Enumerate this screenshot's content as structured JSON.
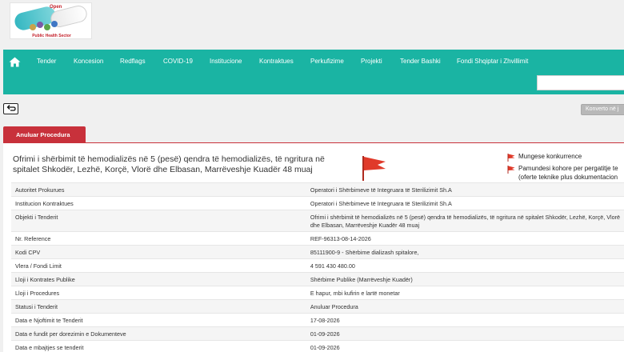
{
  "logo": {
    "brand": "Open",
    "caption": "Public Health Sector"
  },
  "nav": {
    "items": [
      "Tender",
      "Koncesion",
      "Redflags",
      "COVID-19",
      "Institucione",
      "Kontraktues",
      "Perkufizime",
      "Projekti",
      "Tender Bashki",
      "Fondi Shqiptar i Zhvillimit"
    ],
    "search_value": ""
  },
  "toolbar": {
    "convert_label": "Konverto në j"
  },
  "tab": {
    "label": "Anuluar Procedura"
  },
  "procedure": {
    "title": "Ofrimi i shërbimit të hemodializës në 5 (pesë) qendra të hemodializës, të ngritura në spitalet Shkodër, Lezhë, Korçë, Vlorë dhe Elbasan, Marrëveshje Kuadër 48 muaj",
    "flags": [
      "Mungese konkurrence",
      "Pamundesi kohore per pergatitje te",
      "(oferte teknike plus dokumentacion"
    ]
  },
  "details": [
    {
      "label": "Autoritet Prokurues",
      "value": "Operatori i Shërbimeve të Integruara të Sterilizimit Sh.A"
    },
    {
      "label": "Institucion Kontraktues",
      "value": "Operatori i Shërbimeve të Integruara të Sterilizimit Sh.A"
    },
    {
      "label": "Objekti i Tenderit",
      "value": "Ofrimi i shërbimit të hemodializës në 5 (pesë) qendra të hemodializës, të ngritura në spitalet Shkodër, Lezhë, Korçë, Vlorë",
      "value2": "dhe Elbasan, Marrëveshje Kuadër 48 muaj"
    },
    {
      "label": "Nr. Reference",
      "value": "REF-96313-08-14-2026"
    },
    {
      "label": "Kodi CPV",
      "value": "85111900-9 - Shërbime dializash spitalore,"
    },
    {
      "label": "Vlera / Fondi Limit",
      "value": "4 591 430 480.00"
    },
    {
      "label": "Lloji i Kontrates Publike",
      "value": "Shërbime Publike (Marrëveshje Kuadër)"
    },
    {
      "label": "Lloji i Procedures",
      "value": "E hapur, mbi kufirin e lartë monetar"
    },
    {
      "label": "Statusi i Tenderit",
      "value": "Anuluar Procedura"
    },
    {
      "label": "Data e Njoftimit te Tenderit",
      "value": "17-08-2026"
    },
    {
      "label": "Data e fundit per dorezimin e Dokumenteve",
      "value": "01-09-2026"
    },
    {
      "label": "Data e mbajtjes se tenderit",
      "value": "01-09-2026"
    }
  ],
  "colors": {
    "nav_bg": "#1ab4a3",
    "tab_bg": "#c8313b",
    "flag": "#e03a2a"
  },
  "icons": {
    "home": "home-icon",
    "back": "back-arrow-icon",
    "flag": "red-flag-icon"
  }
}
